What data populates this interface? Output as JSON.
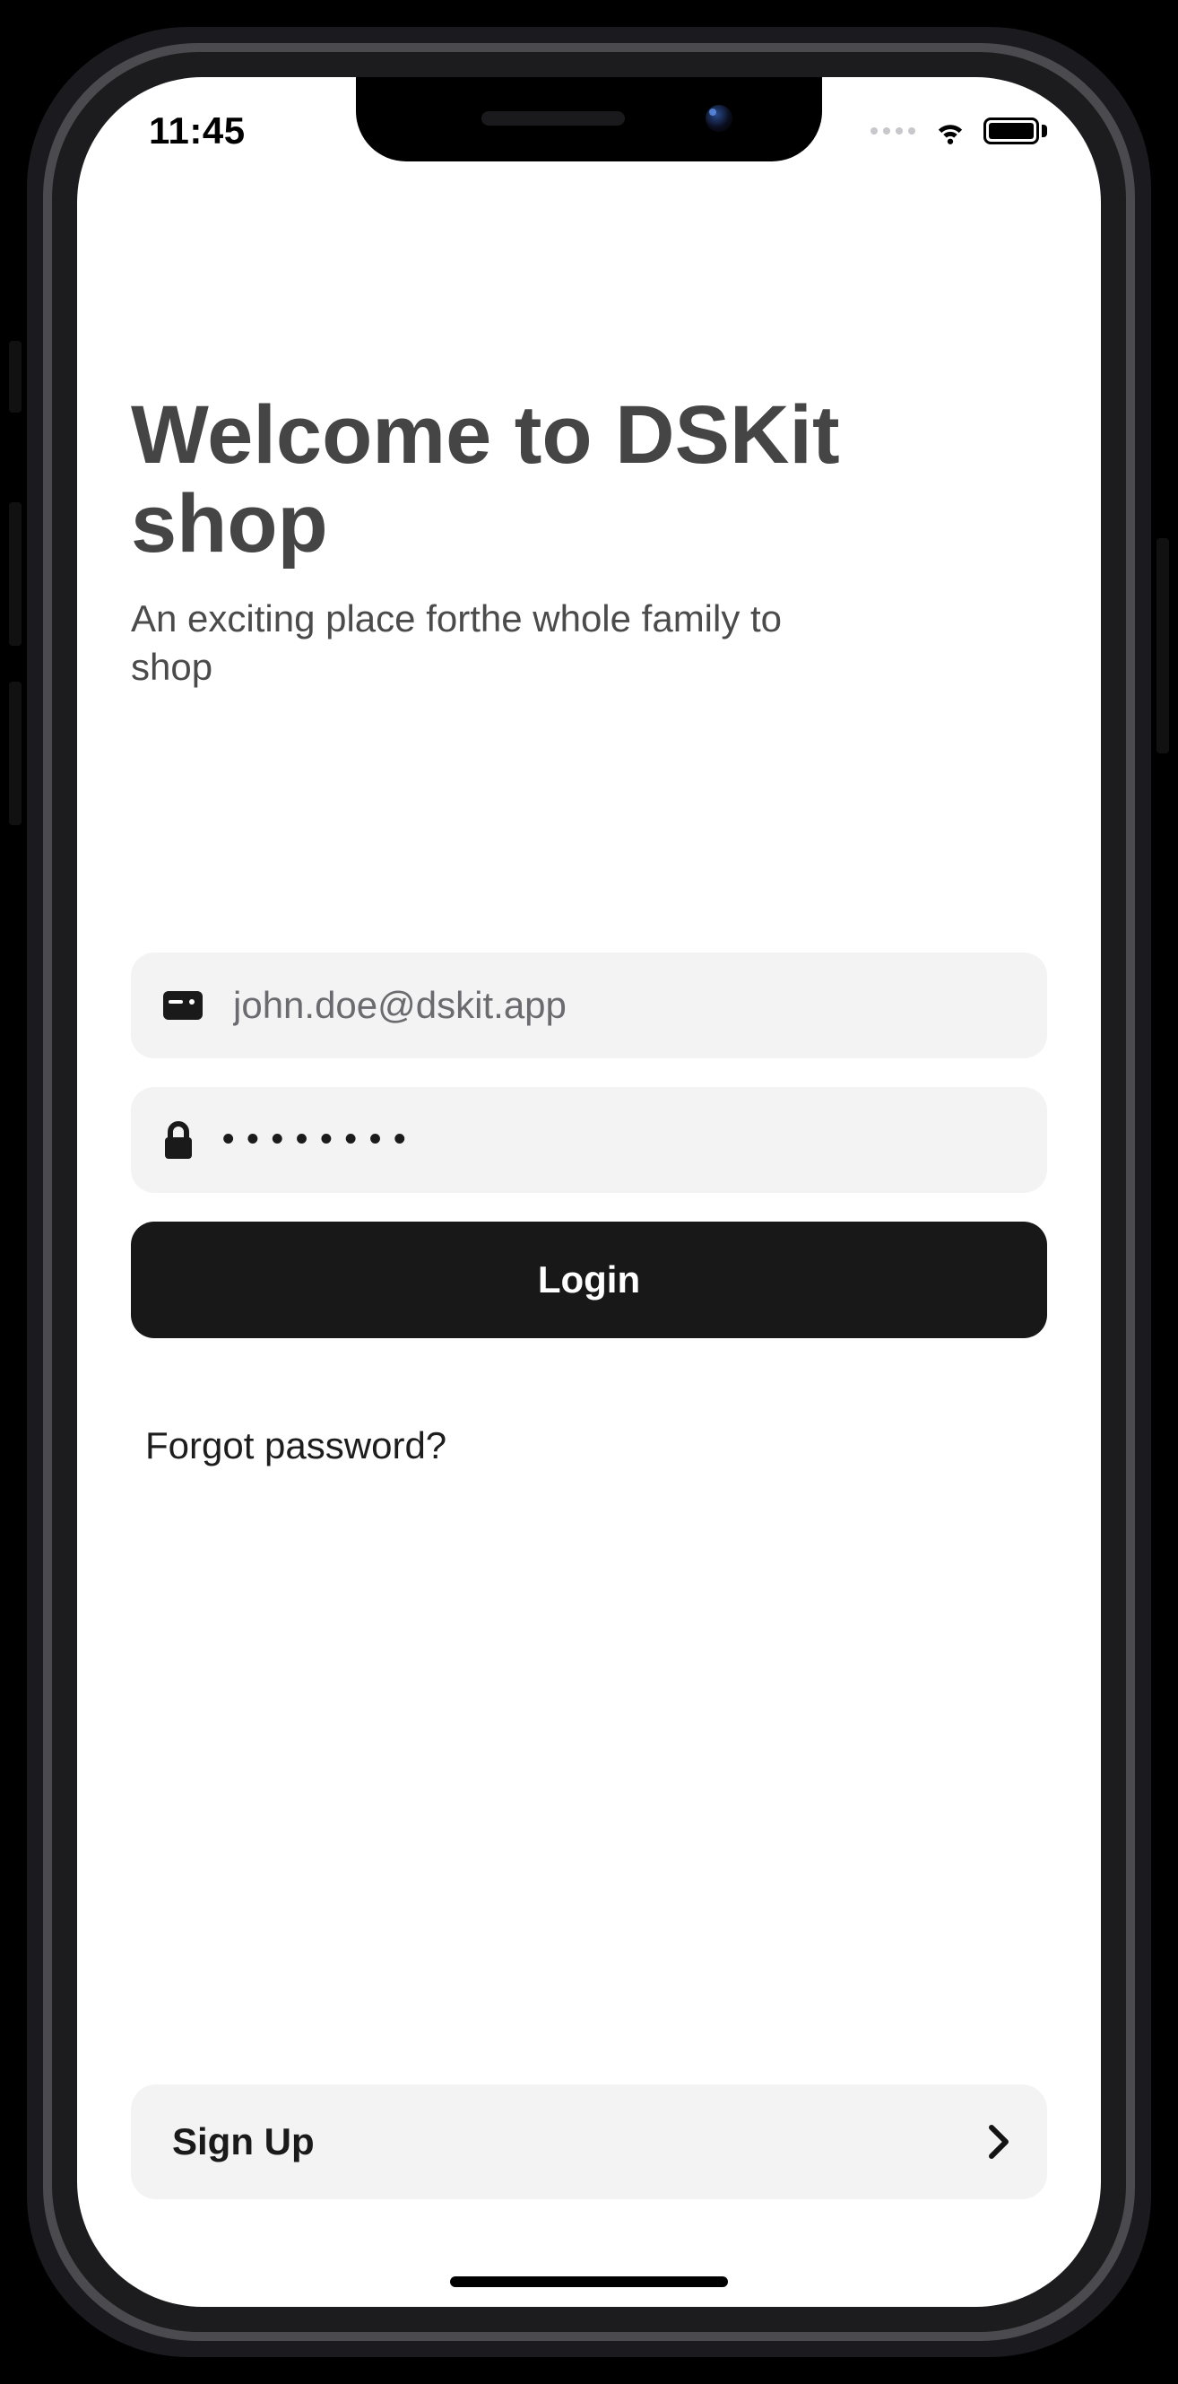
{
  "status": {
    "time": "11:45"
  },
  "header": {
    "title": "Welcome to DSKit shop",
    "subtitle": "An exciting place forthe whole family to shop"
  },
  "form": {
    "email_value": "john.doe@dskit.app",
    "password_value": "••••••••",
    "login_label": "Login",
    "forgot_label": "Forgot password?"
  },
  "signup": {
    "label": "Sign Up"
  }
}
